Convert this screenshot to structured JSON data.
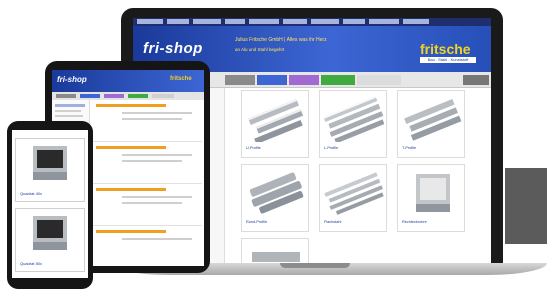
{
  "site": {
    "logo_text": "fri-shop",
    "tagline": "Julius Fritsche GmbH | Alles was ihr Herz",
    "tagline2": "an Alu und Stahl begehrt",
    "brand_name": "fritsche",
    "brand_sub": "Bau . Stahl . Kunststoff"
  },
  "laptop": {
    "tabs": [
      {
        "label": "",
        "color": "#8a8a8a"
      },
      {
        "label": "",
        "color": "#3d66d4"
      },
      {
        "label": "",
        "color": "#a06ad0"
      },
      {
        "label": "",
        "color": "#3faa3f"
      },
      {
        "label": "",
        "color": "#c8c8c8"
      },
      {
        "label": "",
        "color": "#777777"
      }
    ],
    "categories": [
      {
        "caption": "U-Profile"
      },
      {
        "caption": "L-Profile"
      },
      {
        "caption": "T-Profile"
      },
      {
        "caption": "Rund-Profile"
      },
      {
        "caption": "Flachstahl"
      },
      {
        "caption": "Rechteckrohre"
      }
    ]
  },
  "tablet": {
    "logo_text": "fri-shop",
    "brand_name": "fritsche"
  },
  "phone": {
    "cards": [
      {
        "caption": "Quadrat 40x"
      },
      {
        "caption": "Quadrat 50x"
      }
    ]
  },
  "colors": {
    "header_blue": "#1a3a9a",
    "brand_yellow": "#f2d520",
    "device_black": "#151515",
    "banner_grey": "#5b5b5b"
  }
}
